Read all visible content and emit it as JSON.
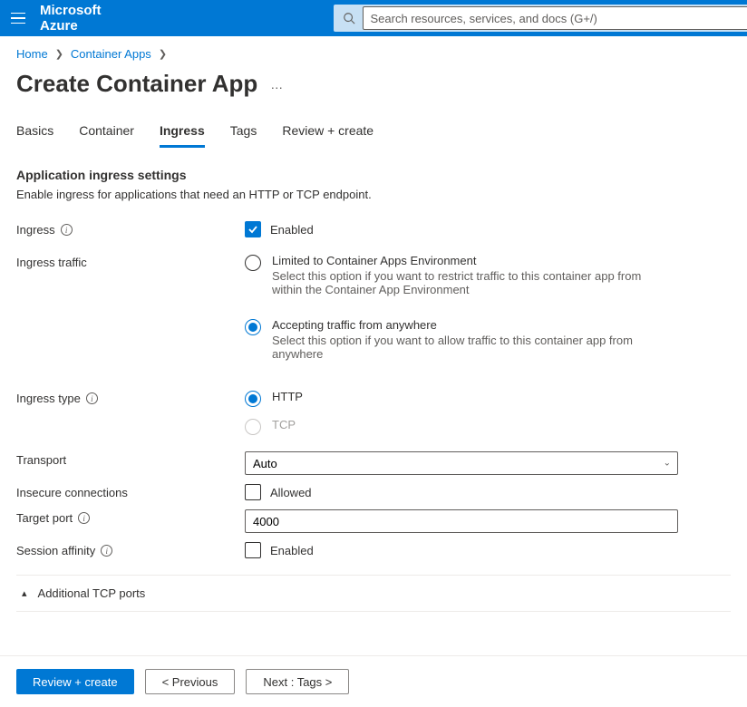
{
  "header": {
    "brand": "Microsoft Azure",
    "search_placeholder": "Search resources, services, and docs (G+/)"
  },
  "breadcrumb": {
    "home": "Home",
    "section": "Container Apps"
  },
  "page": {
    "title": "Create Container App",
    "more": "…"
  },
  "tabs": [
    {
      "label": "Basics"
    },
    {
      "label": "Container"
    },
    {
      "label": "Ingress"
    },
    {
      "label": "Tags"
    },
    {
      "label": "Review + create"
    }
  ],
  "section": {
    "title": "Application ingress settings",
    "desc": "Enable ingress for applications that need an HTTP or TCP endpoint."
  },
  "form": {
    "ingress_label": "Ingress",
    "ingress_enabled_label": "Enabled",
    "ingress_enabled_checked": true,
    "traffic_label": "Ingress traffic",
    "traffic_options": [
      {
        "label": "Limited to Container Apps Environment",
        "desc": "Select this option if you want to restrict traffic to this container app from within the Container App Environment",
        "selected": false
      },
      {
        "label": "Accepting traffic from anywhere",
        "desc": "Select this option if you want to allow traffic to this container app from anywhere",
        "selected": true
      }
    ],
    "type_label": "Ingress type",
    "type_options": [
      {
        "label": "HTTP",
        "selected": true,
        "disabled": false
      },
      {
        "label": "TCP",
        "selected": false,
        "disabled": true
      }
    ],
    "transport_label": "Transport",
    "transport_value": "Auto",
    "insecure_label": "Insecure connections",
    "insecure_allowed_label": "Allowed",
    "insecure_checked": false,
    "target_port_label": "Target port",
    "target_port_value": "4000",
    "session_affinity_label": "Session affinity",
    "session_affinity_enabled_label": "Enabled",
    "session_affinity_checked": false,
    "additional_tcp_label": "Additional TCP ports"
  },
  "footer": {
    "review": "Review + create",
    "previous": "< Previous",
    "next": "Next : Tags >"
  }
}
